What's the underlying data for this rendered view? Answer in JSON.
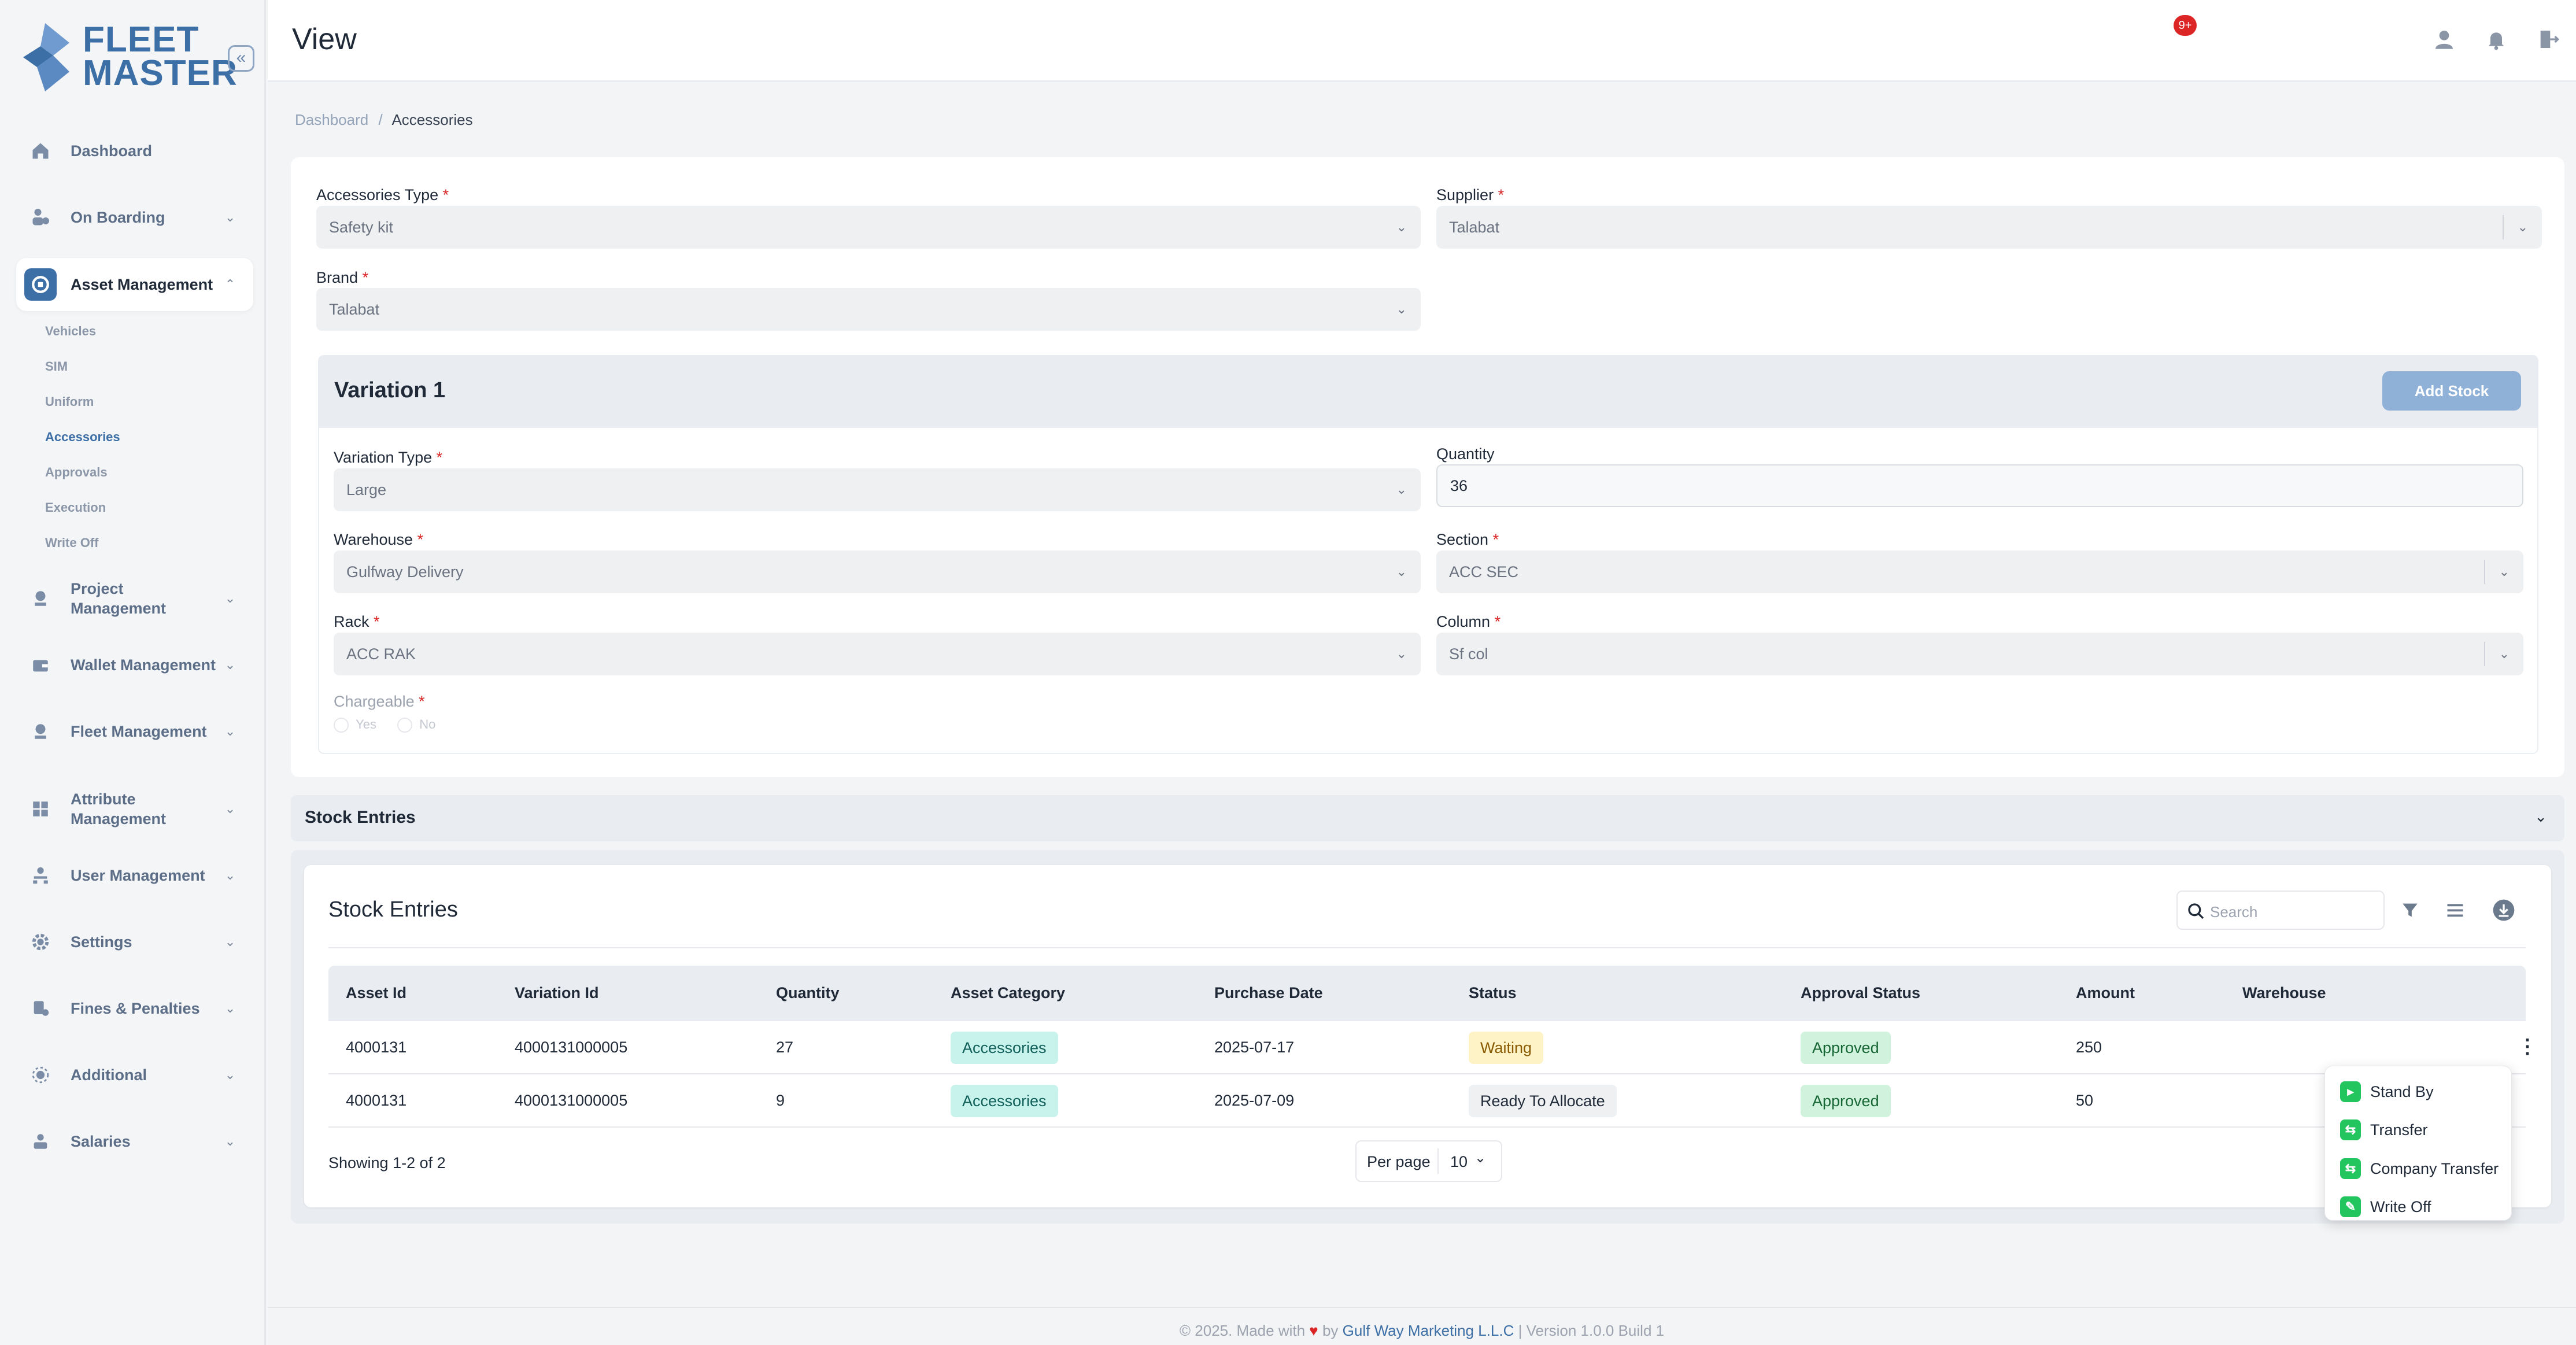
{
  "app": {
    "logo_line1": "FLEET",
    "logo_line2": "MASTER",
    "collapse_glyph": "«"
  },
  "sidebar": {
    "items": [
      {
        "label": "Dashboard",
        "icon": "home-icon"
      },
      {
        "label": "On Boarding",
        "icon": "onboarding-icon"
      },
      {
        "label": "Asset Management",
        "icon": "asset-icon"
      },
      {
        "label": "Project Management",
        "icon": "project-icon"
      },
      {
        "label": "Wallet Management",
        "icon": "wallet-icon"
      },
      {
        "label": "Fleet Management",
        "icon": "fleet-icon"
      },
      {
        "label": "Attribute Management",
        "icon": "attribute-icon"
      },
      {
        "label": "User Management",
        "icon": "users-icon"
      },
      {
        "label": "Settings",
        "icon": "gear-icon"
      },
      {
        "label": "Fines & Penalties",
        "icon": "fines-icon"
      },
      {
        "label": "Additional",
        "icon": "additional-icon"
      },
      {
        "label": "Salaries",
        "icon": "salaries-icon"
      }
    ],
    "asset_sub": [
      "Vehicles",
      "SIM",
      "Uniform",
      "Accessories",
      "Approvals",
      "Execution",
      "Write Off"
    ]
  },
  "header": {
    "title": "View",
    "notification_count": "9+"
  },
  "breadcrumb": {
    "home": "Dashboard",
    "sep": "/",
    "current": "Accessories"
  },
  "form": {
    "accessories_type_label": "Accessories Type",
    "accessories_type_value": "Safety kit",
    "supplier_label": "Supplier",
    "supplier_value": "Talabat",
    "brand_label": "Brand",
    "brand_value": "Talabat",
    "required_mark": "*"
  },
  "variation": {
    "title": "Variation 1",
    "add_stock": "Add Stock",
    "variation_type_label": "Variation Type",
    "variation_type_value": "Large",
    "quantity_label": "Quantity",
    "quantity_value": "36",
    "warehouse_label": "Warehouse",
    "warehouse_value": "Gulfway Delivery",
    "section_label": "Section",
    "section_value": "ACC SEC",
    "rack_label": "Rack",
    "rack_value": "ACC RAK",
    "column_label": "Column",
    "column_value": "Sf col",
    "chargeable_label": "Chargeable",
    "yes": "Yes",
    "no": "No"
  },
  "stock_accordion": {
    "title": "Stock Entries"
  },
  "stock_table": {
    "title": "Stock Entries",
    "search_placeholder": "Search",
    "columns": [
      "Asset Id",
      "Variation Id",
      "Quantity",
      "Asset Category",
      "Purchase Date",
      "Status",
      "Approval Status",
      "Amount",
      "Warehouse"
    ],
    "rows": [
      {
        "asset_id": "4000131",
        "variation_id": "4000131000005",
        "quantity": "27",
        "category": "Accessories",
        "purchase_date": "2025-07-17",
        "status": "Waiting",
        "approval": "Approved",
        "amount": "250",
        "warehouse": ""
      },
      {
        "asset_id": "4000131",
        "variation_id": "4000131000005",
        "quantity": "9",
        "category": "Accessories",
        "purchase_date": "2025-07-09",
        "status": "Ready To Allocate",
        "approval": "Approved",
        "amount": "50",
        "warehouse": ""
      }
    ],
    "showing": "Showing 1-2 of 2",
    "per_page_label": "Per page",
    "per_page_value": "10"
  },
  "row_menu": {
    "items": [
      "Stand By",
      "Transfer",
      "Company Transfer",
      "Write Off"
    ]
  },
  "footer": {
    "prefix": "© 2025. Made with",
    "by": "by",
    "company": "Gulf Way Marketing L.L.C",
    "version": "| Version 1.0.0 Build 1"
  },
  "colors": {
    "brand": "#3d6fa7",
    "accent_button": "#8fb1d8",
    "badge": "#dc2626",
    "menu_icon": "#22c55e"
  }
}
